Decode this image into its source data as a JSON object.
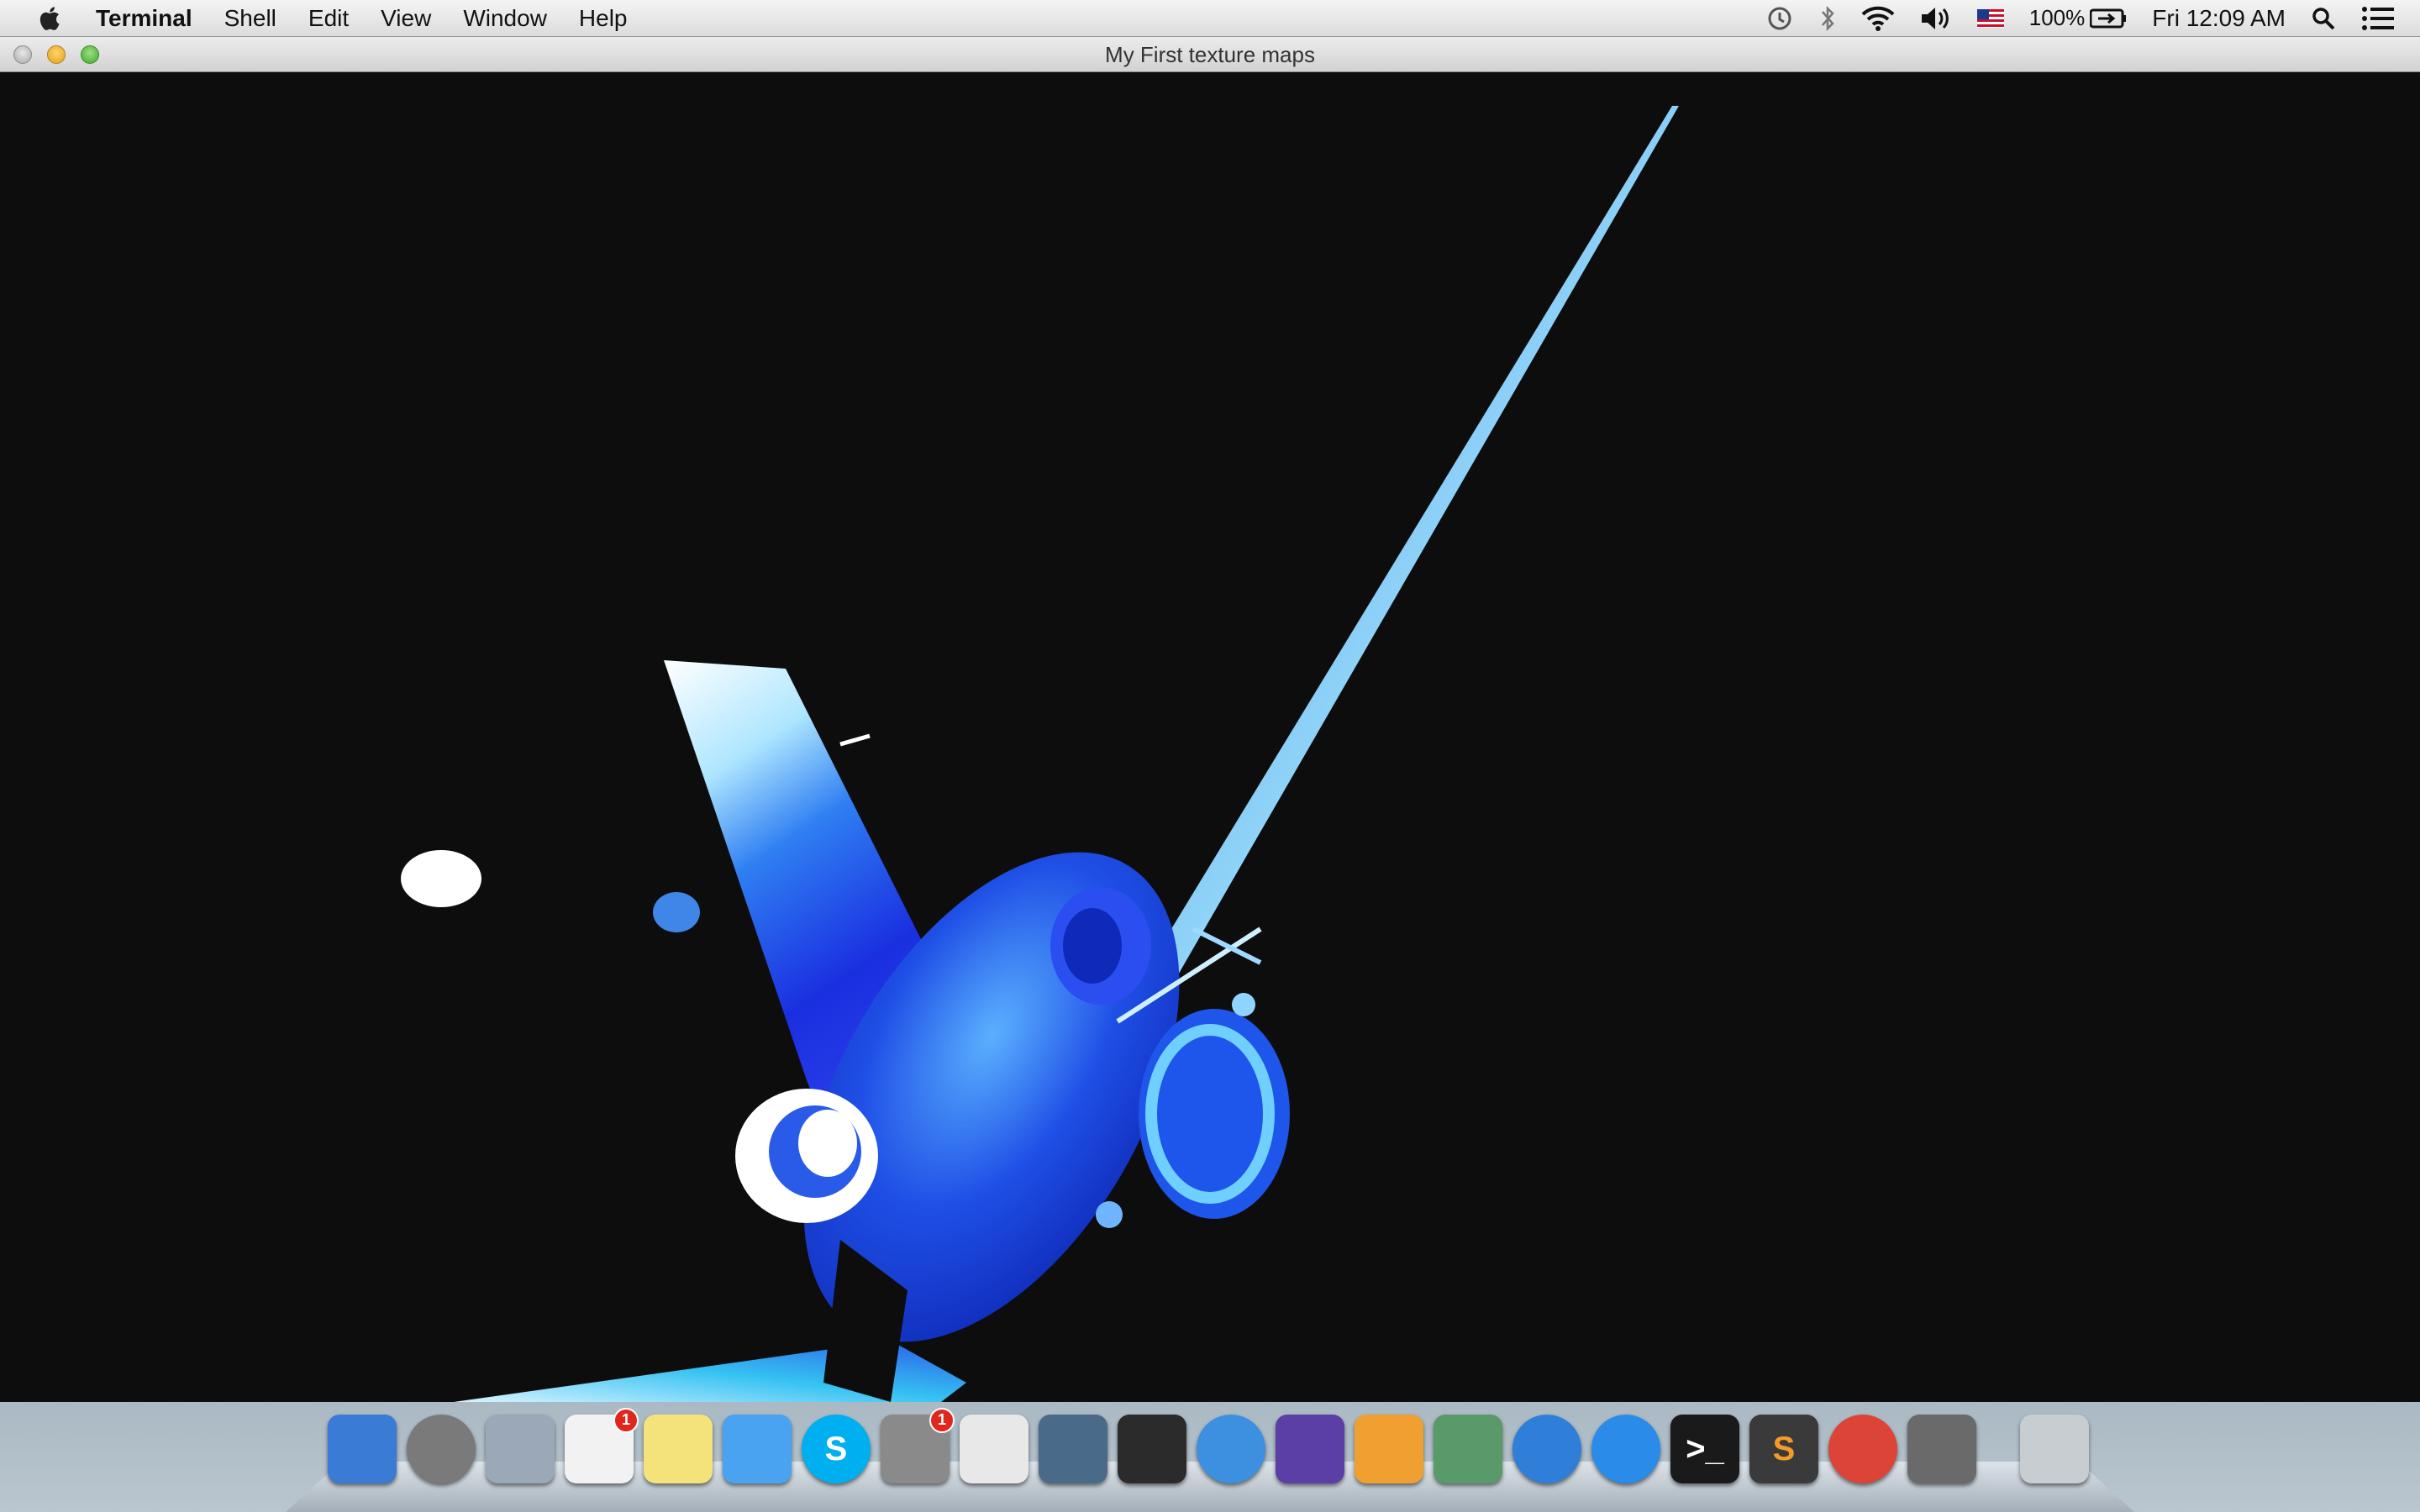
{
  "menubar": {
    "app_name": "Terminal",
    "items": [
      "Shell",
      "Edit",
      "View",
      "Window",
      "Help"
    ],
    "battery": "100%",
    "clock": "Fri 12:09 AM"
  },
  "window": {
    "title": "My First texture maps"
  },
  "dock": {
    "icons": [
      {
        "name": "finder-icon",
        "color": "#3a7bd5"
      },
      {
        "name": "launchpad-icon",
        "color": "#7a7a7a"
      },
      {
        "name": "mail-stamp-icon",
        "color": "#9aa8b8"
      },
      {
        "name": "reminders-icon",
        "color": "#f2f2f2",
        "badge": "1"
      },
      {
        "name": "stickies-icon",
        "color": "#f4e27a"
      },
      {
        "name": "messages-icon",
        "color": "#4aa3f0"
      },
      {
        "name": "skype-icon",
        "color": "#00aff0",
        "glyph": "S"
      },
      {
        "name": "facetime-icon",
        "color": "#8a8a8a",
        "badge": "1"
      },
      {
        "name": "calendar-icon",
        "color": "#e8e8e8"
      },
      {
        "name": "starcraft-icon",
        "color": "#4a6a8a"
      },
      {
        "name": "final-cut-icon",
        "color": "#2b2b2b"
      },
      {
        "name": "safari-icon",
        "color": "#3d8fe0"
      },
      {
        "name": "imovie-icon",
        "color": "#5b3fa6"
      },
      {
        "name": "pages-icon",
        "color": "#f0a030"
      },
      {
        "name": "iphoto-icon",
        "color": "#5a9a6a"
      },
      {
        "name": "itunes-icon",
        "color": "#2f7fd8"
      },
      {
        "name": "app-store-icon",
        "color": "#2a8ce8"
      },
      {
        "name": "terminal-icon",
        "color": "#1a1a1a",
        "glyph": ">_"
      },
      {
        "name": "sublime-text-icon",
        "color": "#3a3a3a",
        "glyph": "S"
      },
      {
        "name": "chrome-icon",
        "color": "#db4437"
      },
      {
        "name": "opengl-window-icon",
        "color": "#6a6a6a"
      },
      {
        "name": "trash-icon",
        "color": "#c8cdd2"
      }
    ]
  }
}
